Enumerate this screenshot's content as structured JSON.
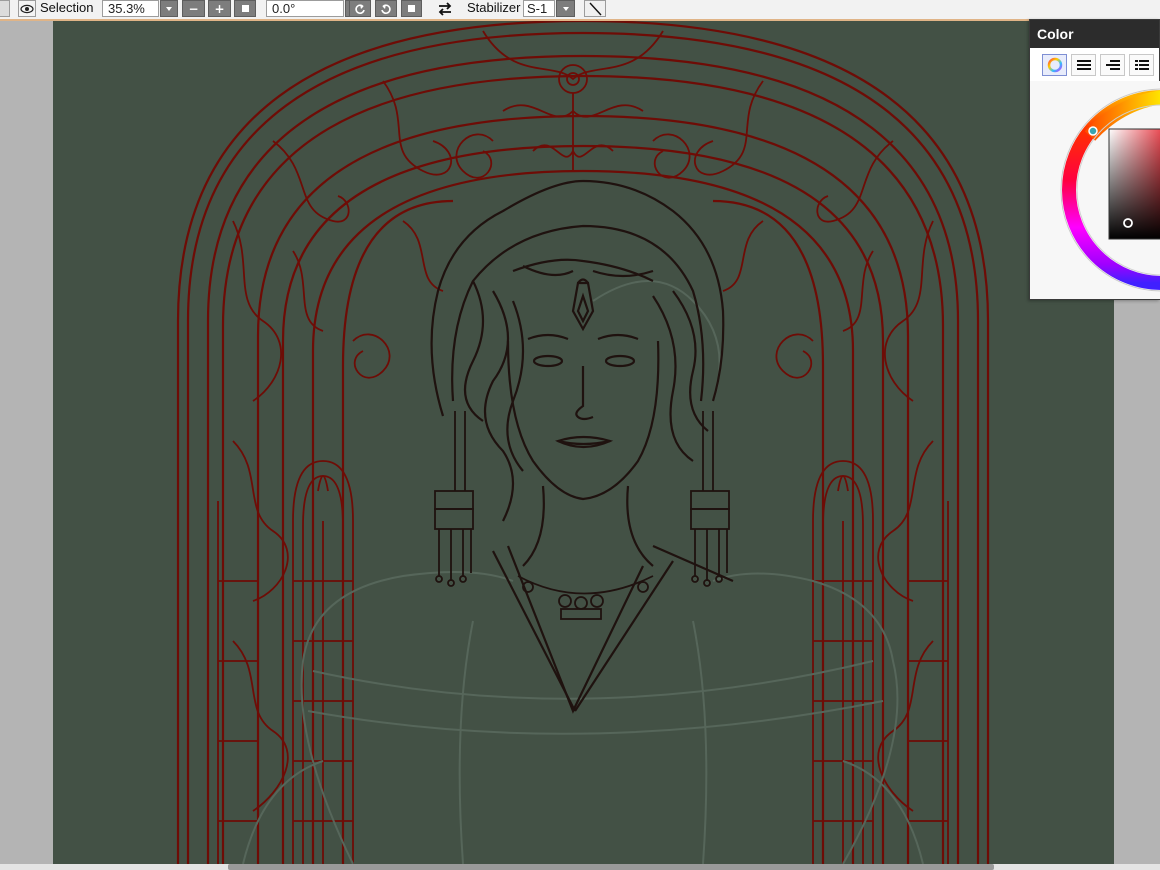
{
  "toolbar": {
    "selection_label": "Selection",
    "zoom_value": "35.3%",
    "rotation_value": "0.0°",
    "stabilizer_label": "Stabilizer",
    "stabilizer_value": "S-1",
    "icons": {
      "visibility": "eye-icon",
      "zoom_dropdown": "chevron-down-icon",
      "zoom_out": "minus-icon",
      "zoom_in": "plus-icon",
      "zoom_reset": "square-icon",
      "rotation_dropdown": "chevron-down-icon",
      "rotate_ccw": "rotate-left-icon",
      "rotate_cw": "rotate-right-icon",
      "rotation_reset": "square-icon",
      "flip": "swap-arrows-icon",
      "stabilizer_dropdown": "chevron-down-icon",
      "line_tool": "diagonal-line-icon"
    }
  },
  "color_panel": {
    "title": "Color",
    "tabs": [
      "color-wheel-tab",
      "rgb-sliders-tab",
      "hsv-sliders-tab",
      "swatches-tab"
    ],
    "active_tab": 0,
    "wheel_marker_hue": "teal",
    "current_color": "#2a1410"
  },
  "canvas": {
    "background_color": "#435145",
    "lineart_red": "#6e0c06",
    "lineart_dark": "#1f120f"
  }
}
